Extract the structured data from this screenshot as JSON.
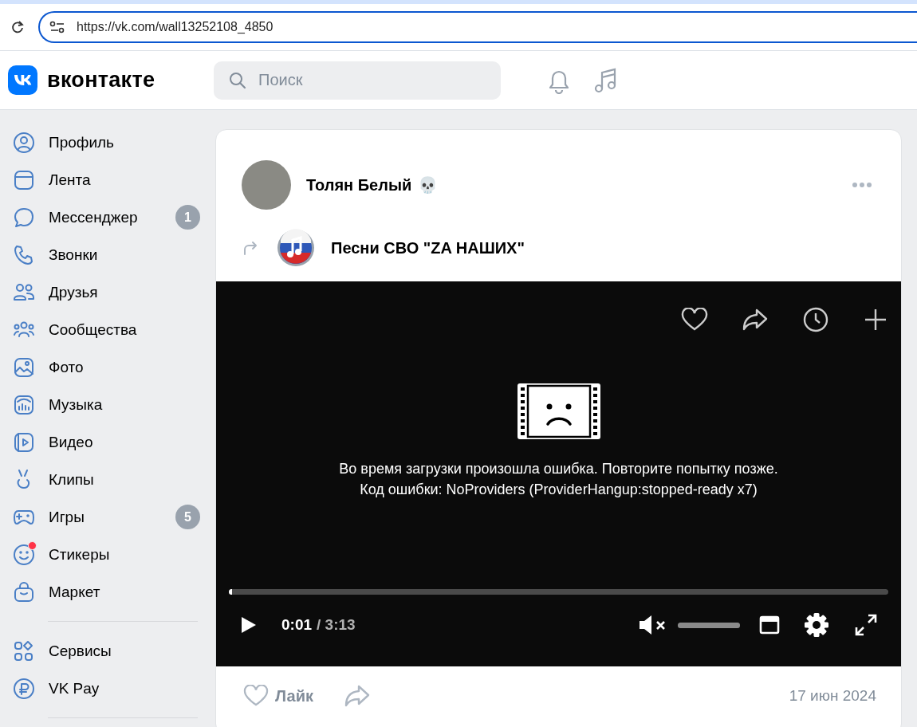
{
  "browser": {
    "url": "https://vk.com/wall13252108_4850"
  },
  "header": {
    "logo_text": "вконтакте",
    "search": {
      "placeholder": "Поиск"
    }
  },
  "sidebar": {
    "groups": [
      {
        "items": [
          {
            "kind": "profile",
            "label": "Профиль",
            "new_dot": false
          },
          {
            "kind": "feed",
            "label": "Лента",
            "new_dot": false
          },
          {
            "kind": "messenger",
            "label": "Мессенджер",
            "badge": "1",
            "new_dot": false
          },
          {
            "kind": "calls",
            "label": "Звонки",
            "new_dot": false
          },
          {
            "kind": "friends",
            "label": "Друзья",
            "new_dot": false
          },
          {
            "kind": "communities",
            "label": "Сообщества",
            "new_dot": false
          },
          {
            "kind": "photo",
            "label": "Фото",
            "new_dot": false
          },
          {
            "kind": "music",
            "label": "Музыка",
            "new_dot": false
          },
          {
            "kind": "video",
            "label": "Видео",
            "new_dot": false
          },
          {
            "kind": "clips",
            "label": "Клипы",
            "new_dot": false
          },
          {
            "kind": "games",
            "label": "Игры",
            "badge": "5",
            "new_dot": false
          },
          {
            "kind": "stickers",
            "label": "Стикеры",
            "new_dot": true
          },
          {
            "kind": "market",
            "label": "Маркет",
            "new_dot": false
          }
        ]
      },
      {
        "items": [
          {
            "kind": "services",
            "label": "Сервисы",
            "new_dot": false
          },
          {
            "kind": "pay",
            "label": "VK Pay",
            "new_dot": false
          }
        ]
      }
    ]
  },
  "post": {
    "author": "Толян Белый",
    "author_emoji": "💀",
    "repost_source": "Песни СВО \"ZA НАШИХ\"",
    "video": {
      "error_lines": [
        "Во время загрузки произошла ошибка. Повторите попытку позже.",
        "Код ошибки: NoProviders (ProviderHangup:stopped-ready x7)"
      ],
      "progress": {
        "level": 0.005
      },
      "current_time": "0:01",
      "duration": "/ 3:13",
      "muted": true,
      "volume": {
        "level": 1
      }
    },
    "like_label": "Лайк",
    "date": "17 июн 2024"
  }
}
